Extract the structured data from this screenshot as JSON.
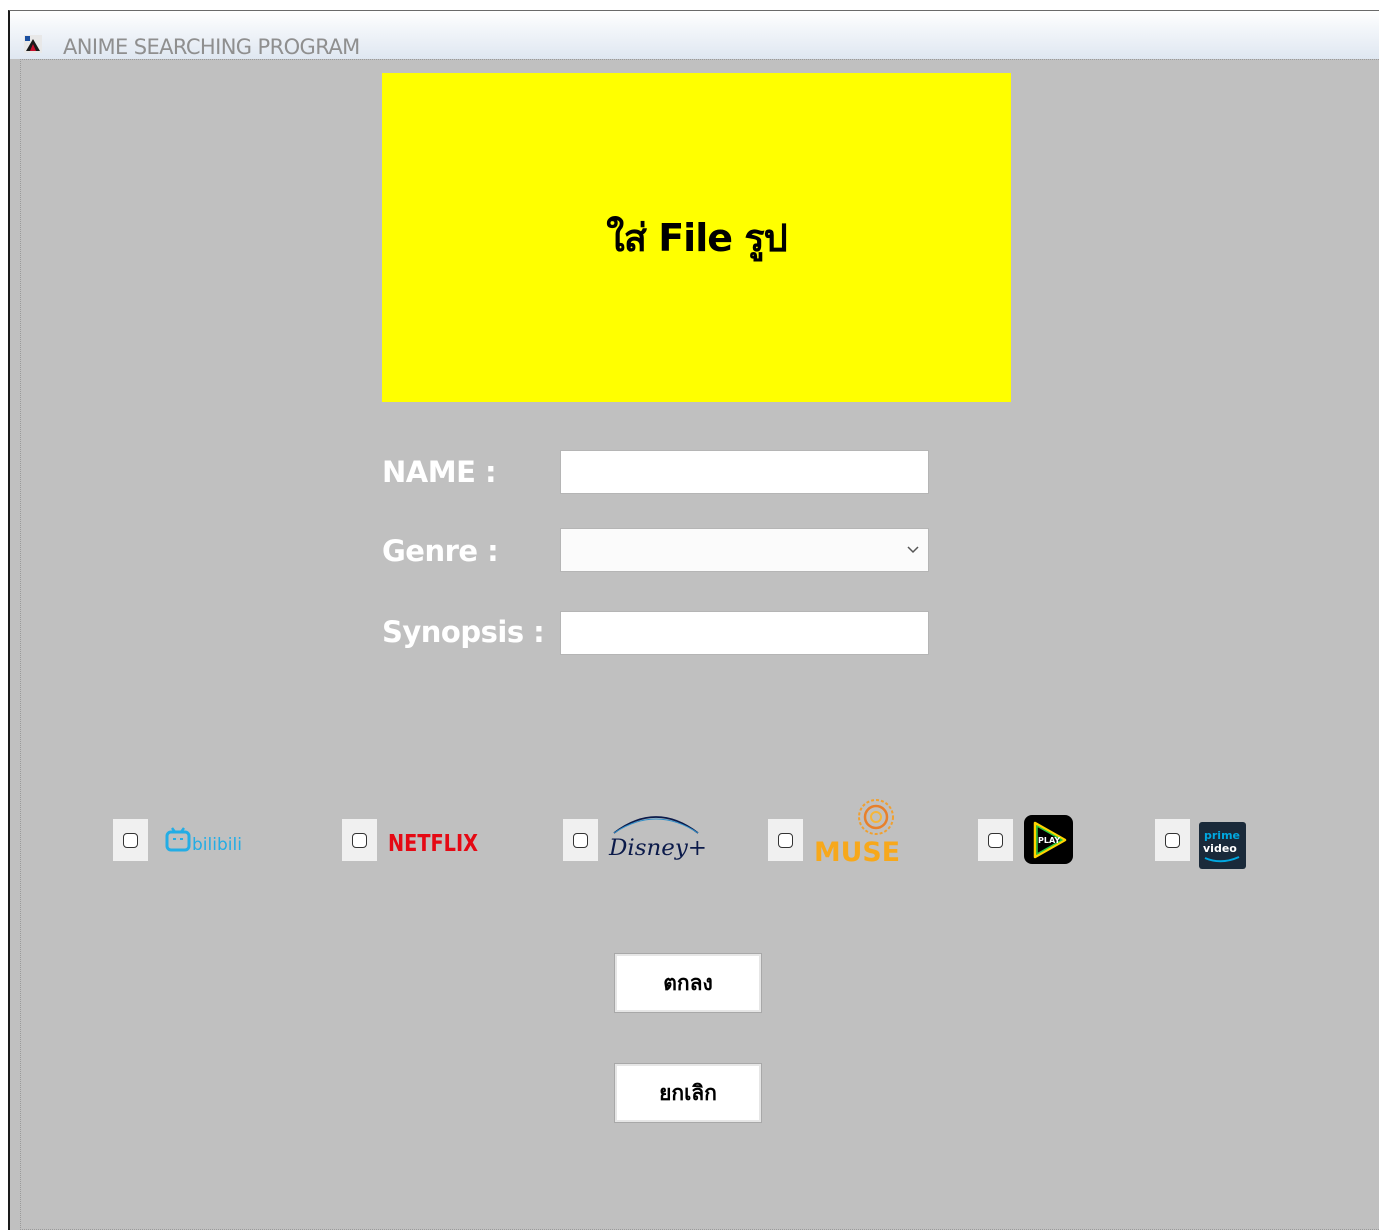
{
  "window": {
    "title": "ANIME SEARCHING PROGRAM"
  },
  "image_placeholder": {
    "label": "ใส่ File รูป",
    "color": "#ffff00"
  },
  "form": {
    "name_label": "NAME :",
    "name_value": "",
    "genre_label": "Genre :",
    "genre_selected": "",
    "synopsis_label": "Synopsis :",
    "synopsis_value": ""
  },
  "platforms": [
    {
      "name": "bilibili",
      "logo_text": "bilibili",
      "checked": false,
      "color": "#23ade5"
    },
    {
      "name": "netflix",
      "logo_text": "NETFLIX",
      "checked": false,
      "color": "#e50914"
    },
    {
      "name": "disney-plus",
      "logo_text": "Disney+",
      "checked": false,
      "color": "#0b1a4a"
    },
    {
      "name": "muse",
      "logo_text": "MUSE",
      "checked": false,
      "color": "#f7a81b"
    },
    {
      "name": "play",
      "logo_text": "PLAY",
      "checked": false,
      "color": "#000000"
    },
    {
      "name": "prime-video",
      "logo_text_1": "prime",
      "logo_text_2": "video",
      "checked": false,
      "color": "#1a2a3a"
    }
  ],
  "buttons": {
    "ok_label": "ตกลง",
    "cancel_label": "ยกเลิก"
  }
}
